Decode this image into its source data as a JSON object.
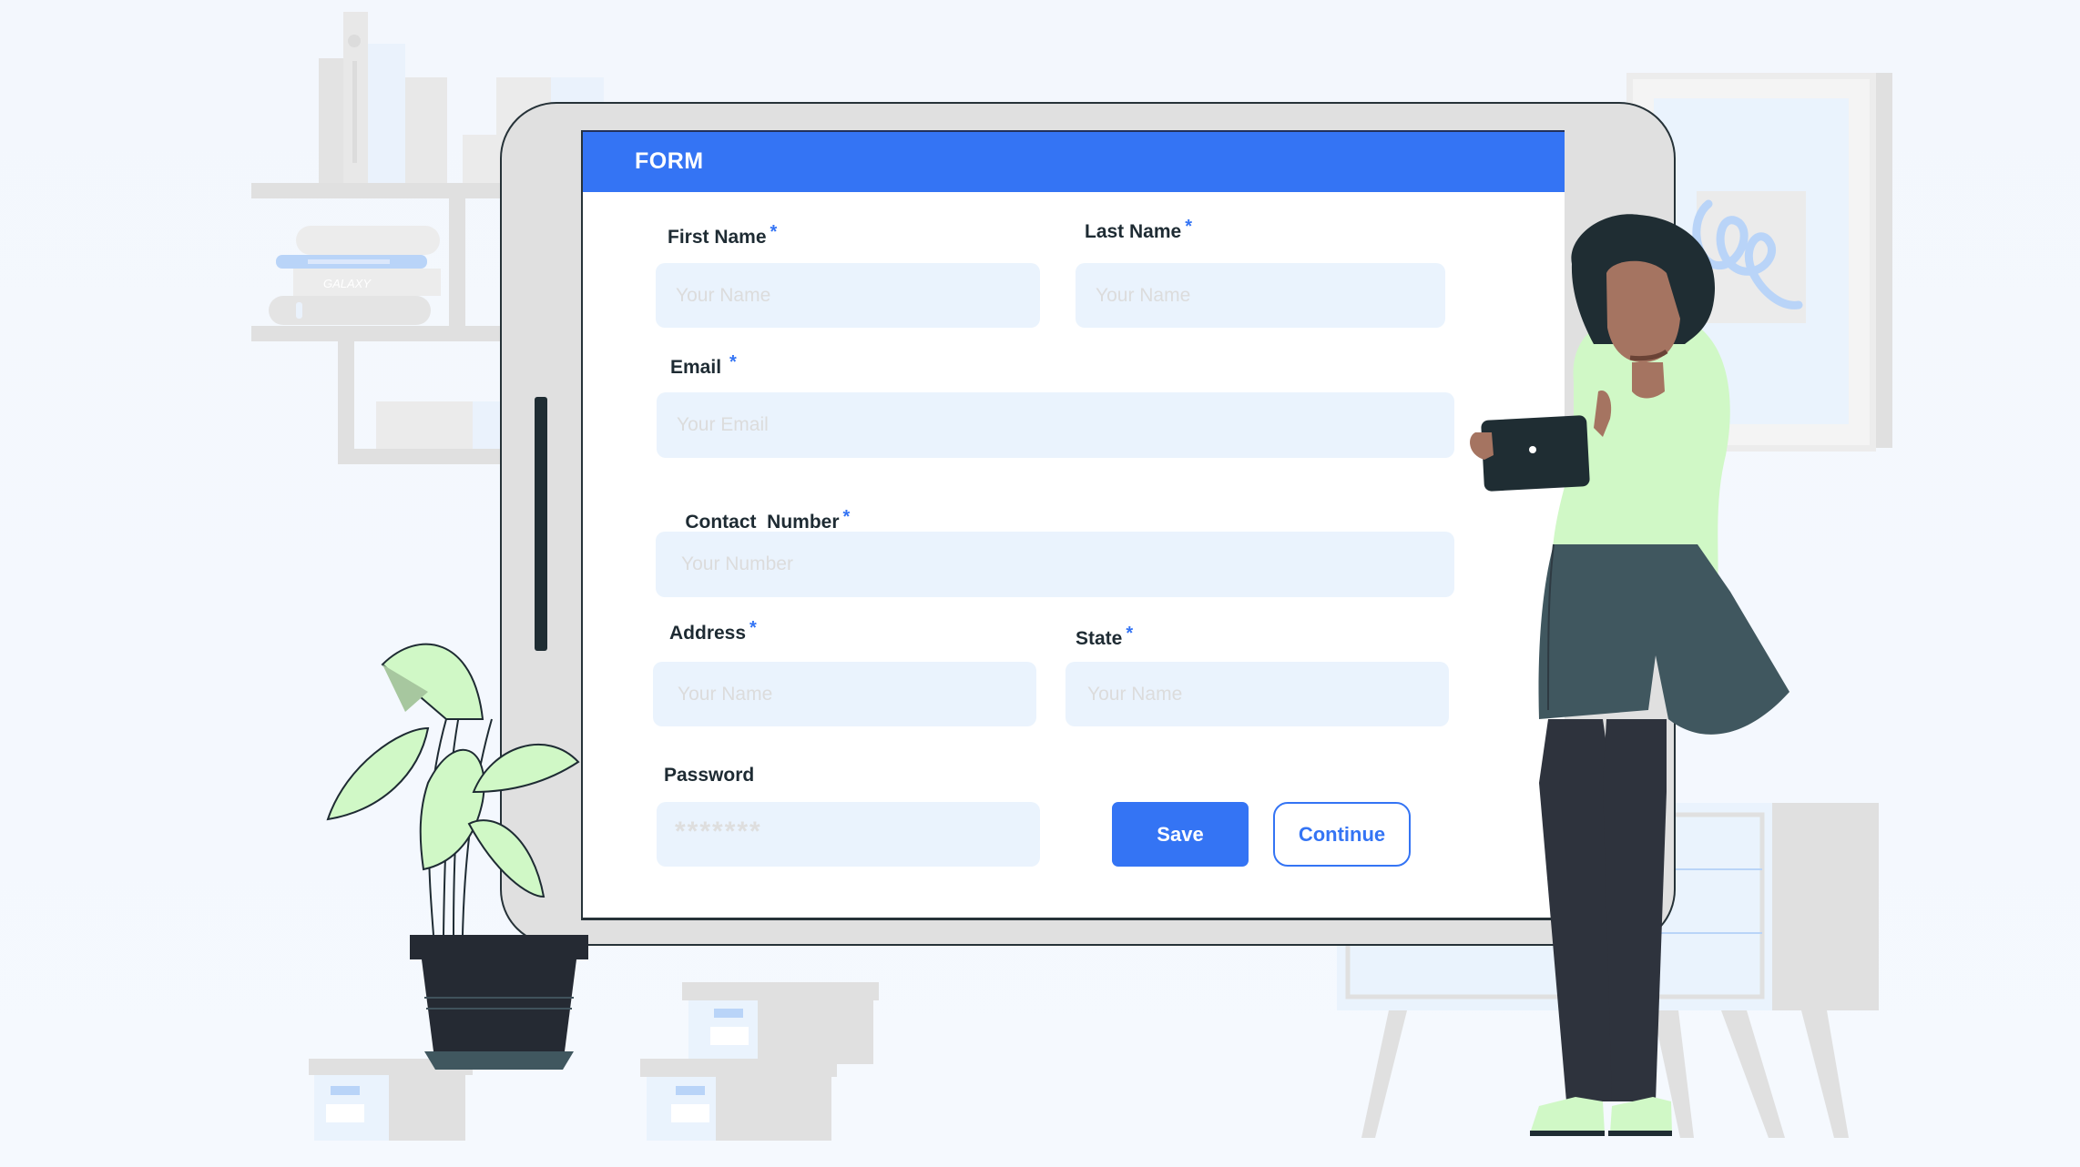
{
  "form": {
    "title": "FORM",
    "required_marker": "*",
    "fields": {
      "first_name": {
        "label": "First Name",
        "placeholder": "Your Name",
        "value": "",
        "required": true
      },
      "last_name": {
        "label": "Last Name",
        "placeholder": "Your Name",
        "value": "",
        "required": true
      },
      "email": {
        "label": "Email",
        "placeholder": "Your Email",
        "value": "",
        "required": true
      },
      "contact_number": {
        "label": "Contact  Number",
        "placeholder": "Your Number",
        "value": "",
        "required": true
      },
      "address": {
        "label": "Address",
        "placeholder": "Your Name",
        "value": "",
        "required": true
      },
      "state": {
        "label": "State",
        "placeholder": "Your Name",
        "value": "",
        "required": true
      },
      "password": {
        "label": "Password",
        "placeholder": "*******",
        "value": "",
        "required": false
      }
    },
    "buttons": {
      "save": "Save",
      "continue": "Continue"
    }
  },
  "illustration": {
    "book_spine_text": "GALAXY"
  },
  "colors": {
    "accent": "#3474f4",
    "field_background": "#eaf3fd",
    "label_text": "#1e2b33",
    "placeholder_text": "#dcdcdc",
    "tablet_frame": "#e0e0e0",
    "background": "#f4f8fd"
  }
}
